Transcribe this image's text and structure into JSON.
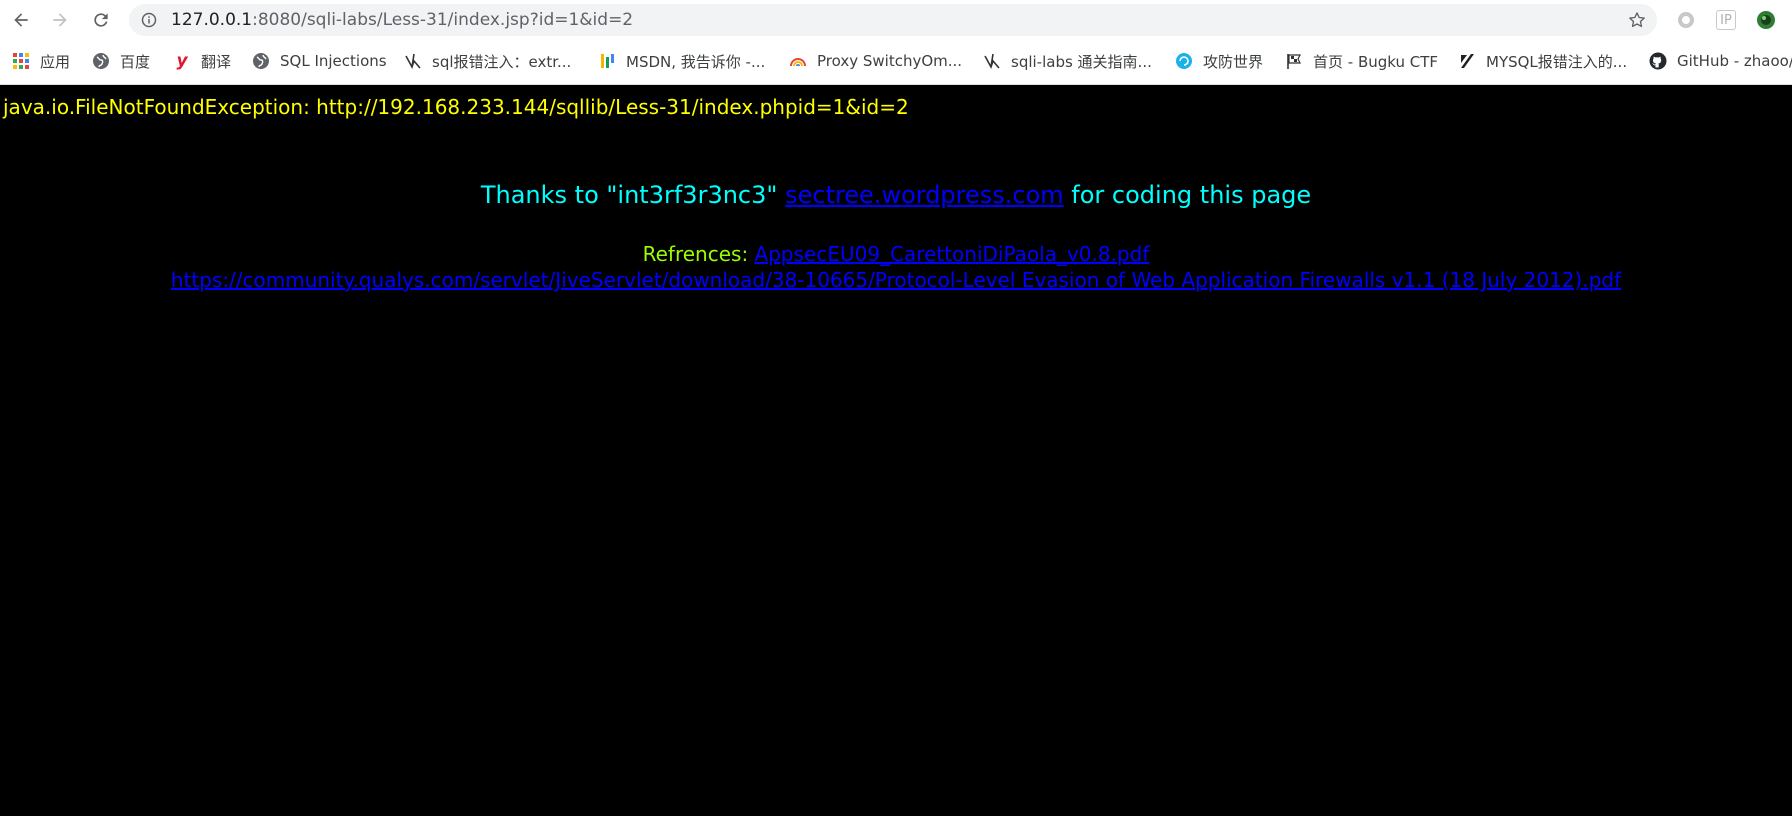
{
  "browser": {
    "url_host": "127.0.0.1",
    "url_rest": ":8080/sqli-labs/Less-31/index.jsp?id=1&id=2",
    "extensions": [
      "circle-extension-icon",
      "ip-extension-icon",
      "profile-avatar-icon"
    ],
    "ip_ext_label": "IP"
  },
  "bookmarks": [
    {
      "label": "应用",
      "icon": "apps-grid-icon"
    },
    {
      "label": "百度",
      "icon": "globe-icon"
    },
    {
      "label": "翻译",
      "icon": "youdao-icon",
      "glyph": "y"
    },
    {
      "label": "SQL Injections",
      "icon": "globe-icon"
    },
    {
      "label": "sql报错注入：extr...",
      "icon": "bird-icon"
    },
    {
      "label": "MSDN, 我告诉你 -...",
      "icon": "msdn-icon"
    },
    {
      "label": "Proxy SwitchyOm...",
      "icon": "rainbow-icon"
    },
    {
      "label": "sqli-labs 通关指南...",
      "icon": "bird-icon"
    },
    {
      "label": "攻防世界",
      "icon": "swirl-icon"
    },
    {
      "label": "首页 - Bugku CTF",
      "icon": "flag-icon"
    },
    {
      "label": "MYSQL报错注入的...",
      "icon": "zhihu-icon"
    },
    {
      "label": "GitHub - zhaoo/",
      "icon": "github-icon"
    }
  ],
  "page": {
    "error": "java.io.FileNotFoundException: http://192.168.233.144/sqllib/Less-31/index.phpid=1&id=2",
    "thanks_prefix": "Thanks to \"int3rf3r3nc3\" ",
    "thanks_link": "sectree.wordpress.com",
    "thanks_suffix": " for coding this page",
    "refs_label": "Refrences: ",
    "ref1": "AppsecEU09_CarettoniDiPaola_v0.8.pdf",
    "ref2": "https://community.qualys.com/servlet/JiveServlet/download/38-10665/Protocol-Level Evasion of Web Application Firewalls v1.1 (18 July 2012).pdf"
  },
  "colors": {
    "error": "#ffff00",
    "thanks": "#00ffff",
    "link": "#0000ff",
    "refs_label": "#99ff00",
    "background": "#000000"
  }
}
